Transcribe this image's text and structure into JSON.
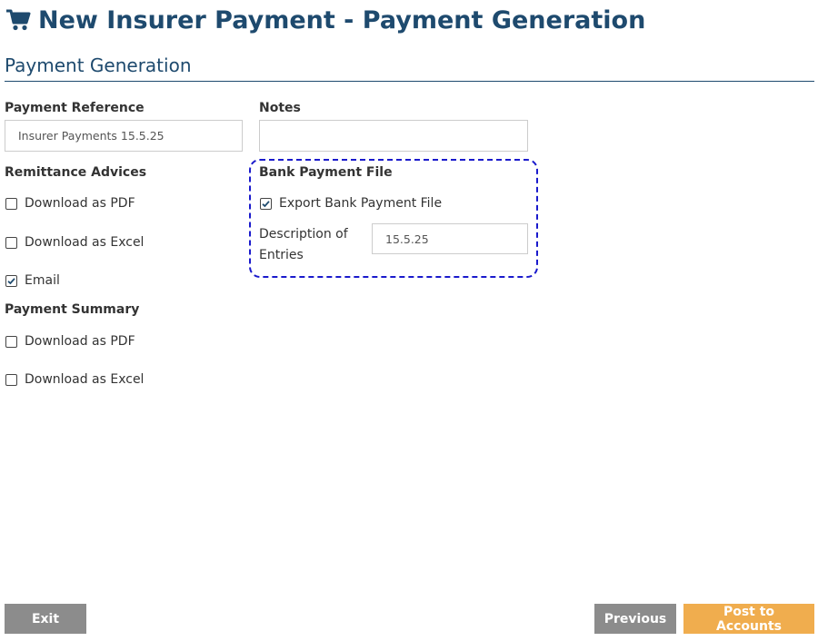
{
  "header": {
    "title": "New Insurer Payment - Payment Generation",
    "icon": "shopping-cart-icon"
  },
  "section": {
    "title": "Payment Generation"
  },
  "payment_reference": {
    "label": "Payment Reference",
    "value": "Insurer Payments 15.5.25"
  },
  "notes": {
    "label": "Notes",
    "value": ""
  },
  "remittance": {
    "title": "Remittance Advices",
    "options": [
      {
        "label": "Download as PDF",
        "checked": false
      },
      {
        "label": "Download as Excel",
        "checked": false
      },
      {
        "label": "Email",
        "checked": true
      }
    ]
  },
  "summary": {
    "title": "Payment Summary",
    "options": [
      {
        "label": "Download as PDF",
        "checked": false
      },
      {
        "label": "Download as Excel",
        "checked": false
      }
    ]
  },
  "bank": {
    "title": "Bank Payment File",
    "export": {
      "label": "Export Bank Payment File",
      "checked": true
    },
    "description_label": "Description of Entries",
    "description_value": "15.5.25"
  },
  "buttons": {
    "exit": "Exit",
    "previous": "Previous",
    "post": "Post to Accounts"
  },
  "colors": {
    "heading": "#1e4a6e",
    "exit_button": "#8c8c8c",
    "previous_button": "#8c8c8c",
    "post_button": "#f0ad4e",
    "highlight_border": "#1a1acc"
  }
}
